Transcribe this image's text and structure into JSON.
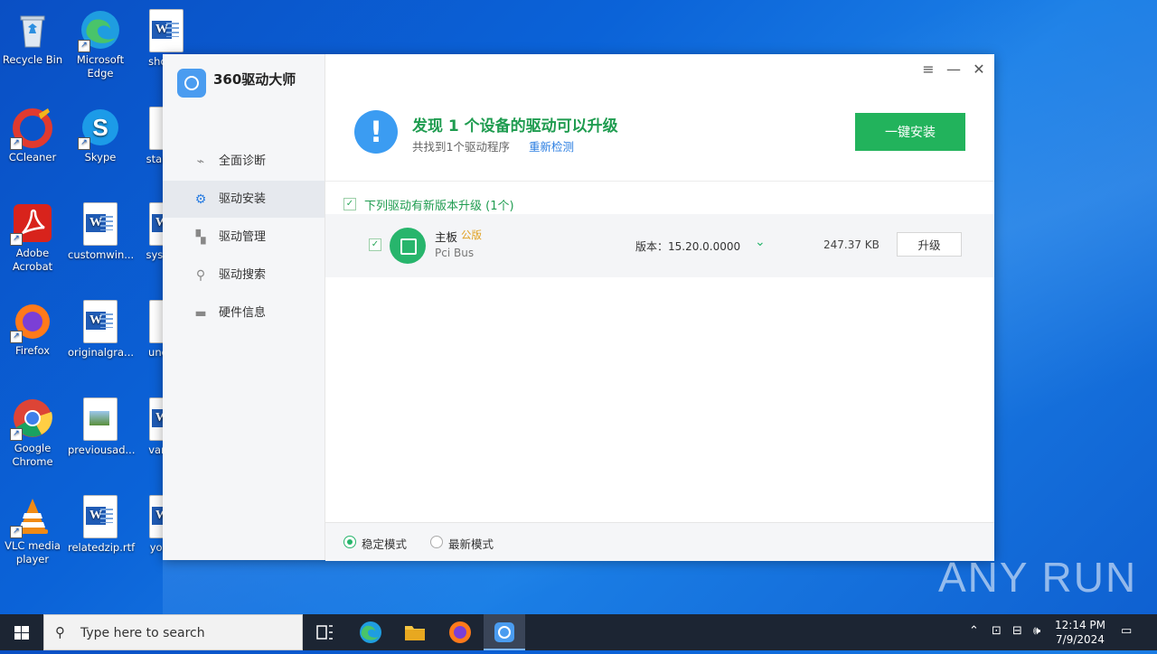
{
  "desktop": {
    "icons": [
      {
        "label": "Recycle Bin"
      },
      {
        "label": "Microsoft Edge"
      },
      {
        "label": "show..."
      },
      {
        "label": "CCleaner"
      },
      {
        "label": "Skype"
      },
      {
        "label": "starte..."
      },
      {
        "label": "Adobe Acrobat"
      },
      {
        "label": "customwin..."
      },
      {
        "label": "syster..."
      },
      {
        "label": "Firefox"
      },
      {
        "label": "originalgra..."
      },
      {
        "label": "unde..."
      },
      {
        "label": "Google Chrome"
      },
      {
        "label": "previousad..."
      },
      {
        "label": "vario..."
      },
      {
        "label": "VLC media player"
      },
      {
        "label": "relatedzip.rtf"
      },
      {
        "label": "yout..."
      }
    ],
    "watermark": "ANY RUN"
  },
  "app": {
    "name": "360驱动大师",
    "nav": [
      {
        "label": "全面诊断",
        "icon": "chart-icon"
      },
      {
        "label": "驱动安装",
        "icon": "gear-icon",
        "active": true
      },
      {
        "label": "驱动管理",
        "icon": "grid-icon"
      },
      {
        "label": "驱动搜索",
        "icon": "search-icon"
      },
      {
        "label": "硬件信息",
        "icon": "hardware-icon"
      }
    ],
    "header": {
      "title": "发现 1 个设备的驱动可以升级",
      "subtitle": "共找到1个驱动程序",
      "recheck": "重新检测",
      "install_all": "一键安装"
    },
    "list_header": "下列驱动有新版本升级 (1个)",
    "drivers": [
      {
        "name": "主板",
        "badge": "公版",
        "bus": "Pci Bus",
        "version": "版本：15.20.0.0000",
        "size": "247.37 KB",
        "action": "升级"
      }
    ],
    "modes": [
      {
        "label": "稳定模式",
        "selected": true
      },
      {
        "label": "最新模式",
        "selected": false
      }
    ]
  },
  "taskbar": {
    "search_placeholder": "Type here to search",
    "time": "12:14 PM",
    "date": "7/9/2024"
  }
}
